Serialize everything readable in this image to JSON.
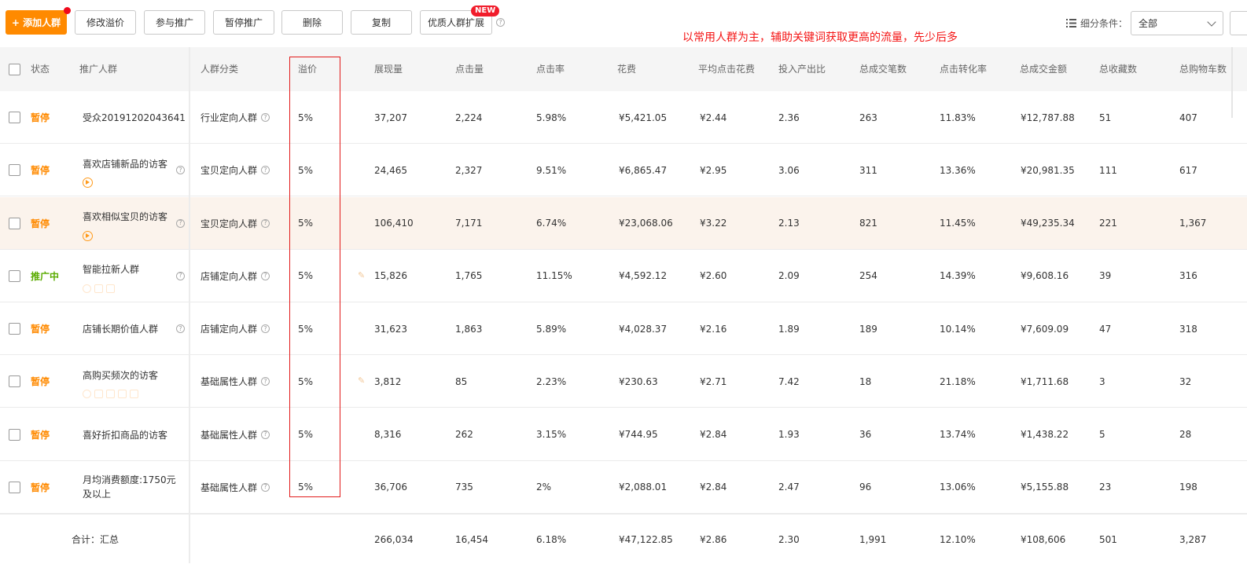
{
  "toolbar": {
    "add_label": "+ 添加人群",
    "buttons": [
      "修改溢价",
      "参与推广",
      "暂停推广",
      "删除",
      "复制",
      "优质人群扩展"
    ],
    "new_badge": "NEW",
    "filter_label": "细分条件：",
    "filter_value": "全部"
  },
  "annotation": "以常用人群为主，辅助关键词获取更高的流量，先少后多",
  "headers": [
    "状态",
    "推广人群",
    "人群分类",
    "溢价",
    "展现量",
    "点击量",
    "点击率",
    "花费",
    "平均点击花费",
    "投入产出比",
    "总成交笔数",
    "点击转化率",
    "总成交金额",
    "总收藏数",
    "总购物车数"
  ],
  "rows": [
    {
      "status": "暂停",
      "name": "受众20191202043641",
      "category": "行业定向人群",
      "premium": "5%",
      "impressions": "37,207",
      "clicks": "2,224",
      "ctr": "5.98%",
      "cost": "¥5,421.05",
      "cpc": "¥2.44",
      "roi": "2.36",
      "orders": "263",
      "cvr": "11.83%",
      "gmv": "¥12,787.88",
      "favorites": "51",
      "carts": "407"
    },
    {
      "status": "暂停",
      "name": "喜欢店铺新品的访客",
      "category": "宝贝定向人群",
      "premium": "5%",
      "impressions": "24,465",
      "clicks": "2,327",
      "ctr": "9.51%",
      "cost": "¥6,865.47",
      "cpc": "¥2.95",
      "roi": "3.06",
      "orders": "311",
      "cvr": "13.36%",
      "gmv": "¥20,981.35",
      "favorites": "111",
      "carts": "617"
    },
    {
      "status": "暂停",
      "name": "喜欢相似宝贝的访客",
      "category": "宝贝定向人群",
      "premium": "5%",
      "impressions": "106,410",
      "clicks": "7,171",
      "ctr": "6.74%",
      "cost": "¥23,068.06",
      "cpc": "¥3.22",
      "roi": "2.13",
      "orders": "821",
      "cvr": "11.45%",
      "gmv": "¥49,235.34",
      "favorites": "221",
      "carts": "1,367"
    },
    {
      "status": "推广中",
      "name": "智能拉新人群",
      "category": "店铺定向人群",
      "premium": "5%",
      "impressions": "15,826",
      "clicks": "1,765",
      "ctr": "11.15%",
      "cost": "¥4,592.12",
      "cpc": "¥2.60",
      "roi": "2.09",
      "orders": "254",
      "cvr": "14.39%",
      "gmv": "¥9,608.16",
      "favorites": "39",
      "carts": "316"
    },
    {
      "status": "暂停",
      "name": "店铺长期价值人群",
      "category": "店铺定向人群",
      "premium": "5%",
      "impressions": "31,623",
      "clicks": "1,863",
      "ctr": "5.89%",
      "cost": "¥4,028.37",
      "cpc": "¥2.16",
      "roi": "1.89",
      "orders": "189",
      "cvr": "10.14%",
      "gmv": "¥7,609.09",
      "favorites": "47",
      "carts": "318"
    },
    {
      "status": "暂停",
      "name": "高购买频次的访客",
      "category": "基础属性人群",
      "premium": "5%",
      "impressions": "3,812",
      "clicks": "85",
      "ctr": "2.23%",
      "cost": "¥230.63",
      "cpc": "¥2.71",
      "roi": "7.42",
      "orders": "18",
      "cvr": "21.18%",
      "gmv": "¥1,711.68",
      "favorites": "3",
      "carts": "32"
    },
    {
      "status": "暂停",
      "name": "喜好折扣商品的访客",
      "category": "基础属性人群",
      "premium": "5%",
      "impressions": "8,316",
      "clicks": "262",
      "ctr": "3.15%",
      "cost": "¥744.95",
      "cpc": "¥2.84",
      "roi": "1.93",
      "orders": "36",
      "cvr": "13.74%",
      "gmv": "¥1,438.22",
      "favorites": "5",
      "carts": "28"
    },
    {
      "status": "暂停",
      "name_line1": "月均消费额度:1750元",
      "name_line2": "及以上",
      "category": "基础属性人群",
      "premium": "5%",
      "impressions": "36,706",
      "clicks": "735",
      "ctr": "2%",
      "cost": "¥2,088.01",
      "cpc": "¥2.84",
      "roi": "2.47",
      "orders": "96",
      "cvr": "13.06%",
      "gmv": "¥5,155.88",
      "favorites": "23",
      "carts": "198"
    }
  ],
  "footer": {
    "label": "合计：汇总",
    "impressions": "266,034",
    "clicks": "16,454",
    "ctr": "6.18%",
    "cost": "¥47,122.85",
    "cpc": "¥2.86",
    "roi": "2.30",
    "orders": "1,991",
    "cvr": "12.10%",
    "gmv": "¥108,606",
    "favorites": "501",
    "carts": "3,287"
  },
  "colors": {
    "accent": "#ff8a00",
    "running": "#5aab00",
    "annotation": "#f41414",
    "highlight_row": "#fbf3ec"
  }
}
